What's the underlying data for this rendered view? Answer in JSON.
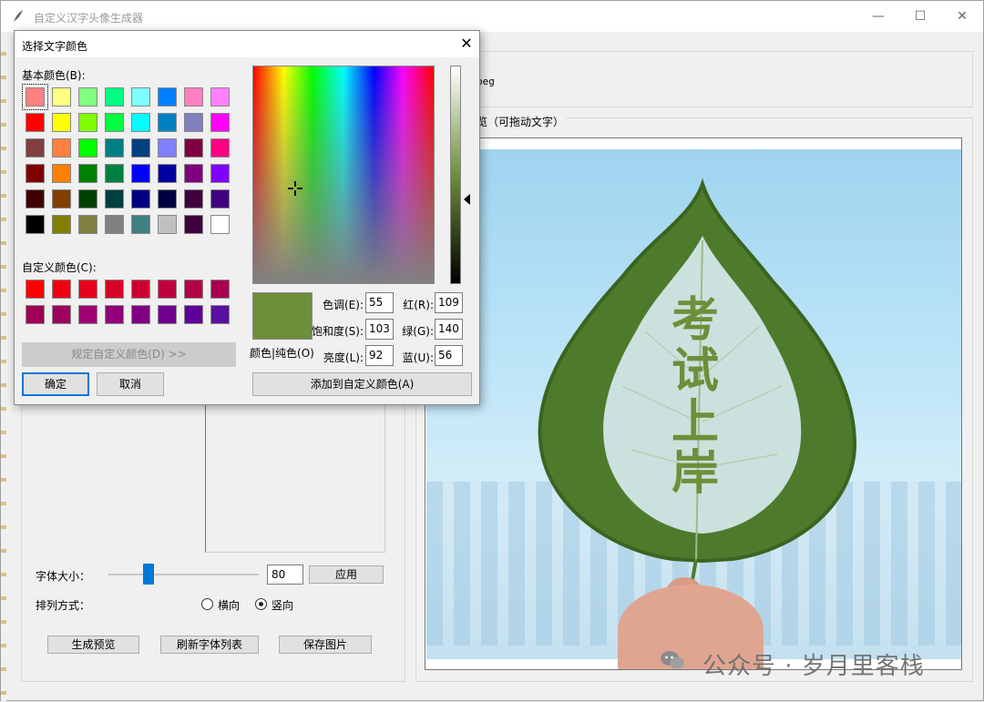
{
  "window": {
    "title": "自定义汉字头像生成器",
    "minimize_icon": "minimize-icon",
    "maximize_icon": "maximize-icon",
    "close_icon": "close-icon"
  },
  "file": {
    "path_fragment": "peg"
  },
  "preview": {
    "legend": "览（可拖动文字）",
    "text_chars": [
      "考",
      "试",
      "上",
      "岸"
    ],
    "text_color": "#6f8e3a"
  },
  "controls": {
    "font_size_label": "字体大小：",
    "font_size_value": "80",
    "font_size_slider_fraction": 0.25,
    "apply_label": "应用",
    "layout_label": "排列方式：",
    "horizontal_label": "横向",
    "vertical_label": "竖向",
    "selected_layout": "vertical",
    "generate_label": "生成预览",
    "refresh_label": "刷新字体列表",
    "save_label": "保存图片"
  },
  "watermark": {
    "text": "公众号 · 岁月里客栈"
  },
  "dialog": {
    "title": "选择文字颜色",
    "basic_colors_label": "基本颜色(B):",
    "custom_colors_label": "自定义颜色(C):",
    "define_custom_label": "规定自定义颜色(D) >>",
    "ok_label": "确定",
    "cancel_label": "取消",
    "color_solid_label": "颜色|纯色(O)",
    "hue_label": "色调(E):",
    "hue": "55",
    "sat_label": "饱和度(S):",
    "sat": "103",
    "lum_label": "亮度(L):",
    "lum": "92",
    "red_label": "红(R):",
    "red": "109",
    "green_label": "绿(G):",
    "green": "140",
    "blue_label": "蓝(U):",
    "blue": "56",
    "add_custom_label": "添加到自定义颜色(A)",
    "selected_color": "#6f8e3a",
    "basic_colors": [
      [
        "#ff8080",
        "#ffff80",
        "#80ff80",
        "#00ff80",
        "#80ffff",
        "#0080ff",
        "#ff80c0",
        "#ff80ff"
      ],
      [
        "#ff0000",
        "#ffff00",
        "#80ff00",
        "#00ff40",
        "#00ffff",
        "#0080c0",
        "#8080c0",
        "#ff00ff"
      ],
      [
        "#804040",
        "#ff8040",
        "#00ff00",
        "#008080",
        "#004080",
        "#8080ff",
        "#800040",
        "#ff0080"
      ],
      [
        "#800000",
        "#ff8000",
        "#008000",
        "#008040",
        "#0000ff",
        "#0000a0",
        "#800080",
        "#8000ff"
      ],
      [
        "#400000",
        "#804000",
        "#004000",
        "#004040",
        "#000080",
        "#000040",
        "#400040",
        "#400080"
      ],
      [
        "#000000",
        "#808000",
        "#808040",
        "#808080",
        "#408080",
        "#c0c0c0",
        "#400040",
        "#ffffff"
      ]
    ],
    "custom_colors": [
      [
        "#ff0000",
        "#f20010",
        "#e6001c",
        "#d90026",
        "#cc0033",
        "#c0003c",
        "#b30045",
        "#a6004e"
      ],
      [
        "#a00055",
        "#a00060",
        "#a00070",
        "#90007a",
        "#800085",
        "#700090",
        "#60009a",
        "#5a10a0"
      ]
    ]
  }
}
